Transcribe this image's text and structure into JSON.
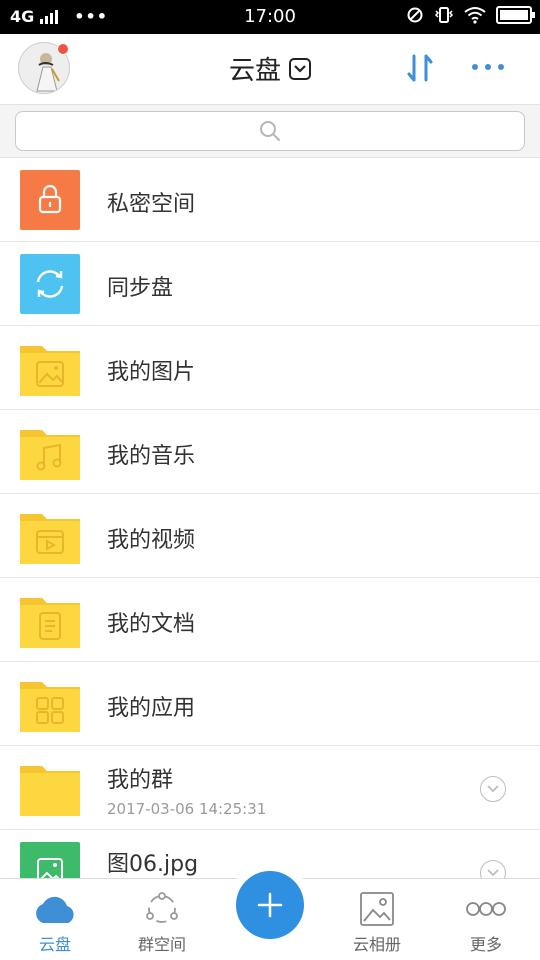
{
  "status_bar": {
    "network": "4G",
    "dots": "•••",
    "time": "17:00"
  },
  "header": {
    "title": "云盘",
    "avatar_icon": "user-avatar",
    "sort_icon": "sort-arrows-icon",
    "more_icon": "more-dots-icon"
  },
  "search": {
    "placeholder": ""
  },
  "list": [
    {
      "label": "私密空间",
      "icon": "lock-icon",
      "color": "#f67a45"
    },
    {
      "label": "同步盘",
      "icon": "sync-icon",
      "color": "#4ec3f1"
    },
    {
      "label": "我的图片",
      "icon": "image-folder-icon",
      "color": "#fcd740"
    },
    {
      "label": "我的音乐",
      "icon": "music-folder-icon",
      "color": "#fcd740"
    },
    {
      "label": "我的视频",
      "icon": "video-folder-icon",
      "color": "#fcd740"
    },
    {
      "label": "我的文档",
      "icon": "document-folder-icon",
      "color": "#fcd740"
    },
    {
      "label": "我的应用",
      "icon": "apps-folder-icon",
      "color": "#fcd740"
    },
    {
      "label": "我的群",
      "sub": "2017-03-06 14:25:31",
      "icon": "folder-icon",
      "color": "#fcd740"
    },
    {
      "label": "图06.jpg",
      "icon": "image-file-icon",
      "color": "#3dbb6a"
    }
  ],
  "bottom_nav": {
    "items": [
      {
        "label": "云盘",
        "icon": "cloud-icon"
      },
      {
        "label": "群空间",
        "icon": "group-space-icon"
      },
      {
        "label": "云相册",
        "icon": "album-icon"
      },
      {
        "label": "更多",
        "icon": "more-icon"
      }
    ],
    "fab_label": "+"
  },
  "colors": {
    "accent": "#3f8fd6",
    "fab": "#2f8fe0",
    "folder": "#fcd740",
    "private_space": "#f67a45",
    "sync": "#4ec3f1",
    "image_file": "#3dbb6a",
    "notification_dot": "#f0533f"
  }
}
